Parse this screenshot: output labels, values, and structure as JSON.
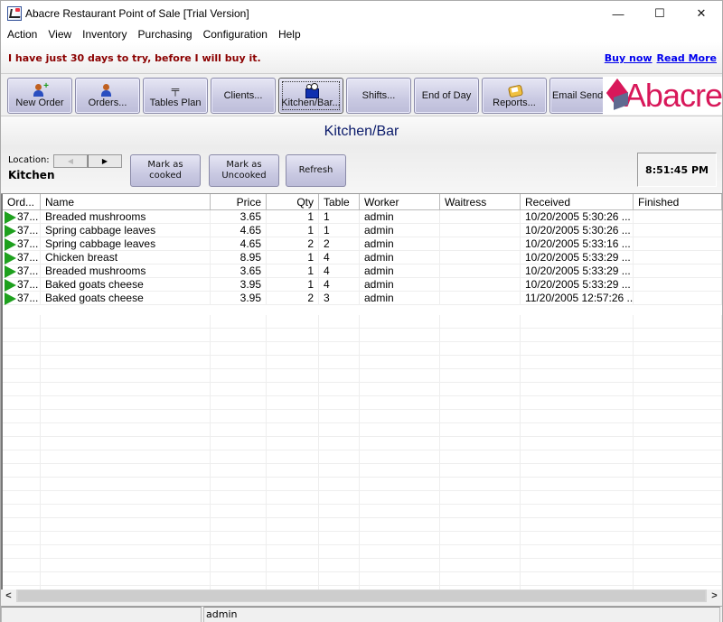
{
  "window": {
    "title": "Abacre Restaurant Point of Sale [Trial Version]",
    "controls": {
      "minimize": "—",
      "maximize": "☐",
      "close": "✕"
    }
  },
  "menu": [
    "Action",
    "View",
    "Inventory",
    "Purchasing",
    "Configuration",
    "Help"
  ],
  "banner": {
    "trial_text": "I have just 30 days to try, before I will buy it.",
    "links": [
      "Buy now",
      "Read More"
    ]
  },
  "toolbar": {
    "buttons": [
      {
        "label": "New Order",
        "icon": "add-person-icon"
      },
      {
        "label": "Orders...",
        "icon": "people-icon"
      },
      {
        "label": "Tables Plan",
        "icon": "table-icon"
      },
      {
        "label": "Clients...",
        "icon": ""
      },
      {
        "label": "Kitchen/Bar...",
        "icon": "kitchen-icon",
        "active": true
      },
      {
        "label": "Shifts...",
        "icon": ""
      },
      {
        "label": "End of Day",
        "icon": ""
      },
      {
        "label": "Reports...",
        "icon": "report-icon"
      },
      {
        "label": "Email Sender",
        "icon": ""
      }
    ],
    "logo_text": "Abacre",
    "brand_color": "#d8185a"
  },
  "panel": {
    "title": "Kitchen/Bar",
    "location_label": "Location:",
    "location_value": "Kitchen",
    "nav_prev": "◀",
    "nav_next": "▶",
    "actions": [
      "Mark as cooked",
      "Mark as Uncooked",
      "Refresh"
    ],
    "clock": "8:51:45 PM"
  },
  "grid": {
    "columns": [
      "Ord...",
      "Name",
      "Price",
      "Qty",
      "Table",
      "Worker",
      "Waitress",
      "Received",
      "Finished"
    ],
    "rows": [
      {
        "order": "37...",
        "name": "Breaded mushrooms",
        "price": "3.65",
        "qty": "1",
        "table": "1",
        "worker": "admin",
        "waitress": "",
        "received": "10/20/2005 5:30:26 ...",
        "finished": ""
      },
      {
        "order": "37...",
        "name": "Spring cabbage leaves",
        "price": "4.65",
        "qty": "1",
        "table": "1",
        "worker": "admin",
        "waitress": "",
        "received": "10/20/2005 5:30:26 ...",
        "finished": ""
      },
      {
        "order": "37...",
        "name": "Spring cabbage leaves",
        "price": "4.65",
        "qty": "2",
        "table": "2",
        "worker": "admin",
        "waitress": "",
        "received": "10/20/2005 5:33:16 ...",
        "finished": ""
      },
      {
        "order": "37...",
        "name": "Chicken breast",
        "price": "8.95",
        "qty": "1",
        "table": "4",
        "worker": "admin",
        "waitress": "",
        "received": "10/20/2005 5:33:29 ...",
        "finished": ""
      },
      {
        "order": "37...",
        "name": "Breaded mushrooms",
        "price": "3.65",
        "qty": "1",
        "table": "4",
        "worker": "admin",
        "waitress": "",
        "received": "10/20/2005 5:33:29 ...",
        "finished": ""
      },
      {
        "order": "37...",
        "name": "Baked goats cheese",
        "price": "3.95",
        "qty": "1",
        "table": "4",
        "worker": "admin",
        "waitress": "",
        "received": "10/20/2005 5:33:29 ...",
        "finished": ""
      },
      {
        "order": "37...",
        "name": "Baked goats cheese",
        "price": "3.95",
        "qty": "2",
        "table": "3",
        "worker": "admin",
        "waitress": "",
        "received": "11/20/2005 12:57:26 ...",
        "finished": ""
      }
    ]
  },
  "scrollbar": {
    "left": "<",
    "right": ">"
  },
  "status": {
    "cell1": "",
    "user": "admin"
  }
}
